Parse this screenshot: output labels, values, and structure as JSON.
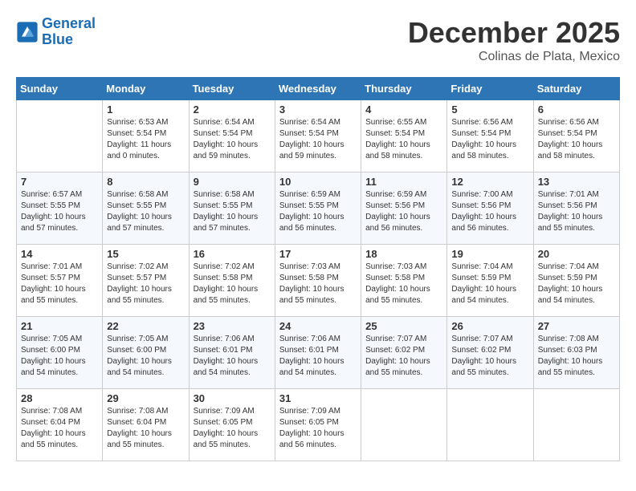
{
  "header": {
    "logo_line1": "General",
    "logo_line2": "Blue",
    "month": "December 2025",
    "location": "Colinas de Plata, Mexico"
  },
  "days_of_week": [
    "Sunday",
    "Monday",
    "Tuesday",
    "Wednesday",
    "Thursday",
    "Friday",
    "Saturday"
  ],
  "weeks": [
    [
      {
        "day": "",
        "info": ""
      },
      {
        "day": "1",
        "info": "Sunrise: 6:53 AM\nSunset: 5:54 PM\nDaylight: 11 hours\nand 0 minutes."
      },
      {
        "day": "2",
        "info": "Sunrise: 6:54 AM\nSunset: 5:54 PM\nDaylight: 10 hours\nand 59 minutes."
      },
      {
        "day": "3",
        "info": "Sunrise: 6:54 AM\nSunset: 5:54 PM\nDaylight: 10 hours\nand 59 minutes."
      },
      {
        "day": "4",
        "info": "Sunrise: 6:55 AM\nSunset: 5:54 PM\nDaylight: 10 hours\nand 58 minutes."
      },
      {
        "day": "5",
        "info": "Sunrise: 6:56 AM\nSunset: 5:54 PM\nDaylight: 10 hours\nand 58 minutes."
      },
      {
        "day": "6",
        "info": "Sunrise: 6:56 AM\nSunset: 5:54 PM\nDaylight: 10 hours\nand 58 minutes."
      }
    ],
    [
      {
        "day": "7",
        "info": "Sunrise: 6:57 AM\nSunset: 5:55 PM\nDaylight: 10 hours\nand 57 minutes."
      },
      {
        "day": "8",
        "info": "Sunrise: 6:58 AM\nSunset: 5:55 PM\nDaylight: 10 hours\nand 57 minutes."
      },
      {
        "day": "9",
        "info": "Sunrise: 6:58 AM\nSunset: 5:55 PM\nDaylight: 10 hours\nand 57 minutes."
      },
      {
        "day": "10",
        "info": "Sunrise: 6:59 AM\nSunset: 5:55 PM\nDaylight: 10 hours\nand 56 minutes."
      },
      {
        "day": "11",
        "info": "Sunrise: 6:59 AM\nSunset: 5:56 PM\nDaylight: 10 hours\nand 56 minutes."
      },
      {
        "day": "12",
        "info": "Sunrise: 7:00 AM\nSunset: 5:56 PM\nDaylight: 10 hours\nand 56 minutes."
      },
      {
        "day": "13",
        "info": "Sunrise: 7:01 AM\nSunset: 5:56 PM\nDaylight: 10 hours\nand 55 minutes."
      }
    ],
    [
      {
        "day": "14",
        "info": "Sunrise: 7:01 AM\nSunset: 5:57 PM\nDaylight: 10 hours\nand 55 minutes."
      },
      {
        "day": "15",
        "info": "Sunrise: 7:02 AM\nSunset: 5:57 PM\nDaylight: 10 hours\nand 55 minutes."
      },
      {
        "day": "16",
        "info": "Sunrise: 7:02 AM\nSunset: 5:58 PM\nDaylight: 10 hours\nand 55 minutes."
      },
      {
        "day": "17",
        "info": "Sunrise: 7:03 AM\nSunset: 5:58 PM\nDaylight: 10 hours\nand 55 minutes."
      },
      {
        "day": "18",
        "info": "Sunrise: 7:03 AM\nSunset: 5:58 PM\nDaylight: 10 hours\nand 55 minutes."
      },
      {
        "day": "19",
        "info": "Sunrise: 7:04 AM\nSunset: 5:59 PM\nDaylight: 10 hours\nand 54 minutes."
      },
      {
        "day": "20",
        "info": "Sunrise: 7:04 AM\nSunset: 5:59 PM\nDaylight: 10 hours\nand 54 minutes."
      }
    ],
    [
      {
        "day": "21",
        "info": "Sunrise: 7:05 AM\nSunset: 6:00 PM\nDaylight: 10 hours\nand 54 minutes."
      },
      {
        "day": "22",
        "info": "Sunrise: 7:05 AM\nSunset: 6:00 PM\nDaylight: 10 hours\nand 54 minutes."
      },
      {
        "day": "23",
        "info": "Sunrise: 7:06 AM\nSunset: 6:01 PM\nDaylight: 10 hours\nand 54 minutes."
      },
      {
        "day": "24",
        "info": "Sunrise: 7:06 AM\nSunset: 6:01 PM\nDaylight: 10 hours\nand 54 minutes."
      },
      {
        "day": "25",
        "info": "Sunrise: 7:07 AM\nSunset: 6:02 PM\nDaylight: 10 hours\nand 55 minutes."
      },
      {
        "day": "26",
        "info": "Sunrise: 7:07 AM\nSunset: 6:02 PM\nDaylight: 10 hours\nand 55 minutes."
      },
      {
        "day": "27",
        "info": "Sunrise: 7:08 AM\nSunset: 6:03 PM\nDaylight: 10 hours\nand 55 minutes."
      }
    ],
    [
      {
        "day": "28",
        "info": "Sunrise: 7:08 AM\nSunset: 6:04 PM\nDaylight: 10 hours\nand 55 minutes."
      },
      {
        "day": "29",
        "info": "Sunrise: 7:08 AM\nSunset: 6:04 PM\nDaylight: 10 hours\nand 55 minutes."
      },
      {
        "day": "30",
        "info": "Sunrise: 7:09 AM\nSunset: 6:05 PM\nDaylight: 10 hours\nand 55 minutes."
      },
      {
        "day": "31",
        "info": "Sunrise: 7:09 AM\nSunset: 6:05 PM\nDaylight: 10 hours\nand 56 minutes."
      },
      {
        "day": "",
        "info": ""
      },
      {
        "day": "",
        "info": ""
      },
      {
        "day": "",
        "info": ""
      }
    ]
  ]
}
